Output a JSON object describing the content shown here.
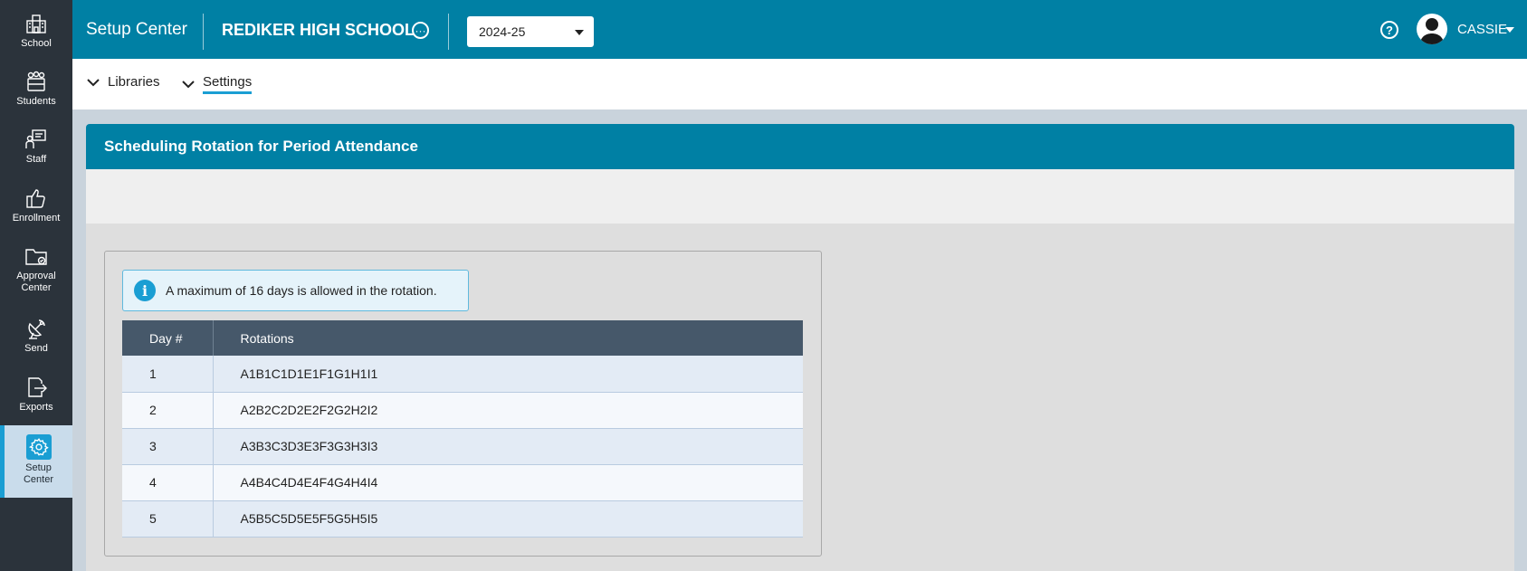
{
  "nav": {
    "items": [
      {
        "label": "School",
        "icon": "school-icon"
      },
      {
        "label": "Students",
        "icon": "students-icon"
      },
      {
        "label": "Staff",
        "icon": "staff-icon"
      },
      {
        "label": "Enrollment",
        "icon": "thumbs-up-icon"
      },
      {
        "label": "Approval\nCenter",
        "icon": "folder-icon"
      },
      {
        "label": "Send",
        "icon": "satellite-icon"
      },
      {
        "label": "Exports",
        "icon": "export-icon"
      },
      {
        "label": "Setup\nCenter",
        "icon": "gear-icon",
        "active": true
      }
    ]
  },
  "header": {
    "app_title": "Setup Center",
    "school_name": "REDIKER HIGH SCHOOL",
    "year": "2024-25",
    "user_name": "CASSIE",
    "help_glyph": "?"
  },
  "subnav": {
    "libraries": "Libraries",
    "settings": "Settings"
  },
  "panel": {
    "title": "Scheduling Rotation for Period Attendance",
    "info_text": "A maximum of 16 days is allowed in the rotation.",
    "columns": [
      "Day #",
      "Rotations"
    ],
    "rows": [
      {
        "day": "1",
        "rotation": "A1B1C1D1E1F1G1H1I1"
      },
      {
        "day": "2",
        "rotation": "A2B2C2D2E2F2G2H2I2"
      },
      {
        "day": "3",
        "rotation": "A3B3C3D3E3F3G3H3I3"
      },
      {
        "day": "4",
        "rotation": "A4B4C4D4E4F4G4H4I4"
      },
      {
        "day": "5",
        "rotation": "A5B5C5D5E5F5G5H5I5"
      }
    ]
  },
  "colors": {
    "header_blue": "#0080a4",
    "nav_dark": "#2b333b",
    "accent": "#1a9ed3",
    "table_header": "#46586a"
  }
}
